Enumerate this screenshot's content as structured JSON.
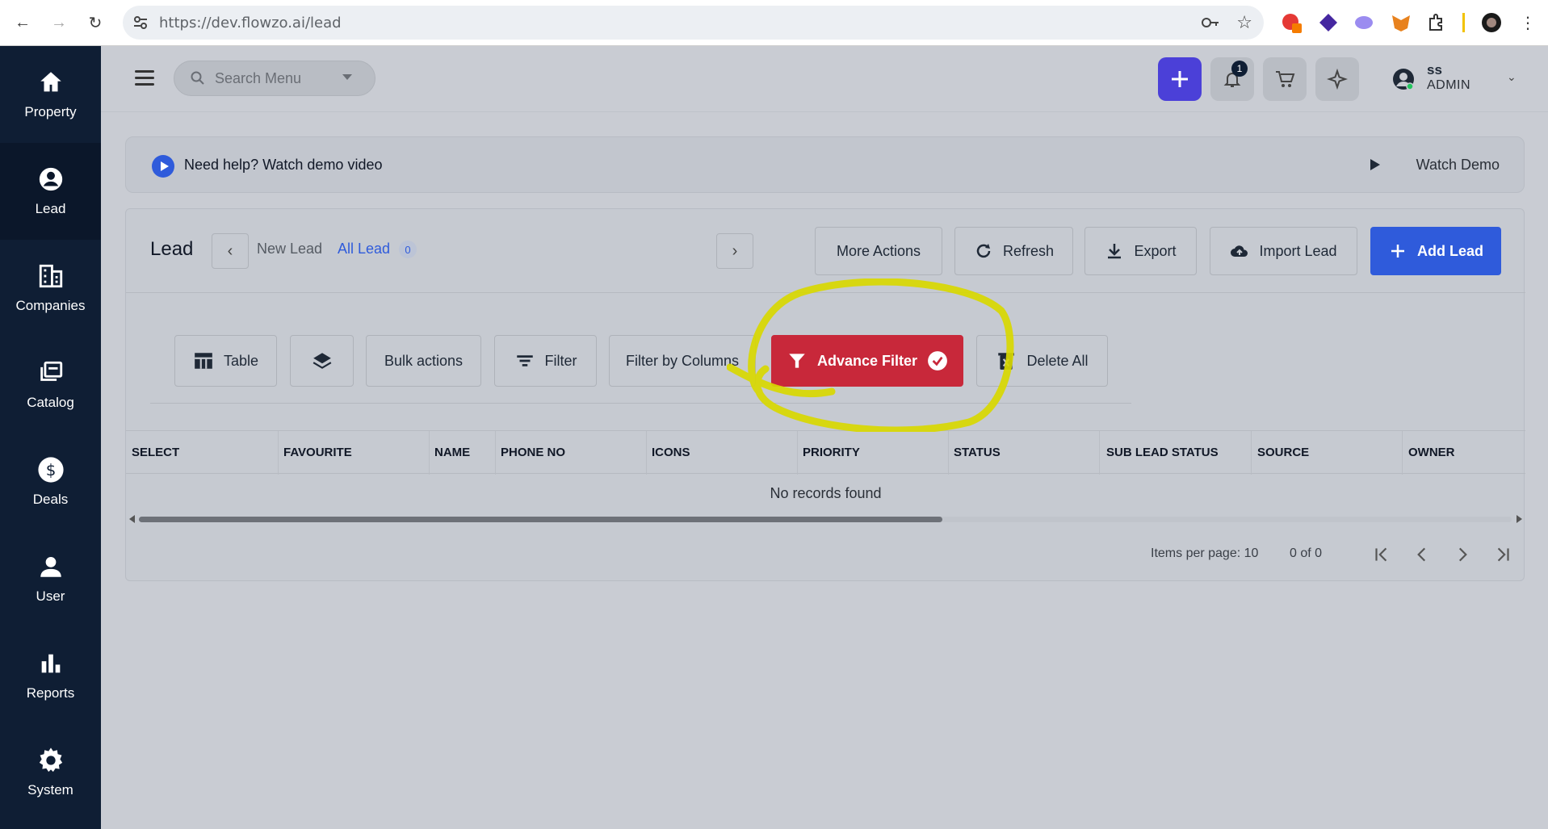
{
  "browser": {
    "url": "https://dev.flowzo.ai/lead"
  },
  "sidebar": {
    "items": [
      {
        "label": "Property",
        "icon": "home-icon"
      },
      {
        "label": "Lead",
        "icon": "user-circle-icon"
      },
      {
        "label": "Companies",
        "icon": "building-icon"
      },
      {
        "label": "Catalog",
        "icon": "catalog-icon"
      },
      {
        "label": "Deals",
        "icon": "dollar-icon"
      },
      {
        "label": "User",
        "icon": "person-icon"
      },
      {
        "label": "Reports",
        "icon": "bar-chart-icon"
      },
      {
        "label": "System",
        "icon": "gear-icon"
      }
    ],
    "active": "Lead"
  },
  "topbar": {
    "search_placeholder": "Search Menu",
    "notification_count": "1",
    "user_name": "ss",
    "user_role": "ADMIN"
  },
  "help": {
    "text": "Need help? Watch demo video",
    "watch_label": "Watch Demo"
  },
  "lead": {
    "title": "Lead",
    "tabs": [
      {
        "label": "New Lead"
      },
      {
        "label": "All Lead",
        "count": "0"
      }
    ],
    "actions": {
      "more": "More Actions",
      "refresh": "Refresh",
      "export": "Export",
      "import": "Import Lead",
      "add": "Add Lead"
    },
    "toolbar": {
      "table": "Table",
      "bulk": "Bulk actions",
      "filter": "Filter",
      "filter_columns": "Filter by Columns",
      "advance": "Advance Filter",
      "delete_all": "Delete All"
    },
    "columns": [
      "SELECT",
      "FAVOURITE",
      "NAME",
      "PHONE NO",
      "ICONS",
      "PRIORITY",
      "STATUS",
      "SUB LEAD STATUS",
      "SOURCE",
      "OWNER"
    ],
    "empty": "No records found",
    "pager": {
      "items_per_page": "Items per page: 10",
      "range": "0 of 0"
    }
  },
  "colors": {
    "sidebar": "#0f1e34",
    "primary": "#2f5bdb",
    "advance_filter": "#c8283a",
    "highlight": "#d8d800"
  }
}
